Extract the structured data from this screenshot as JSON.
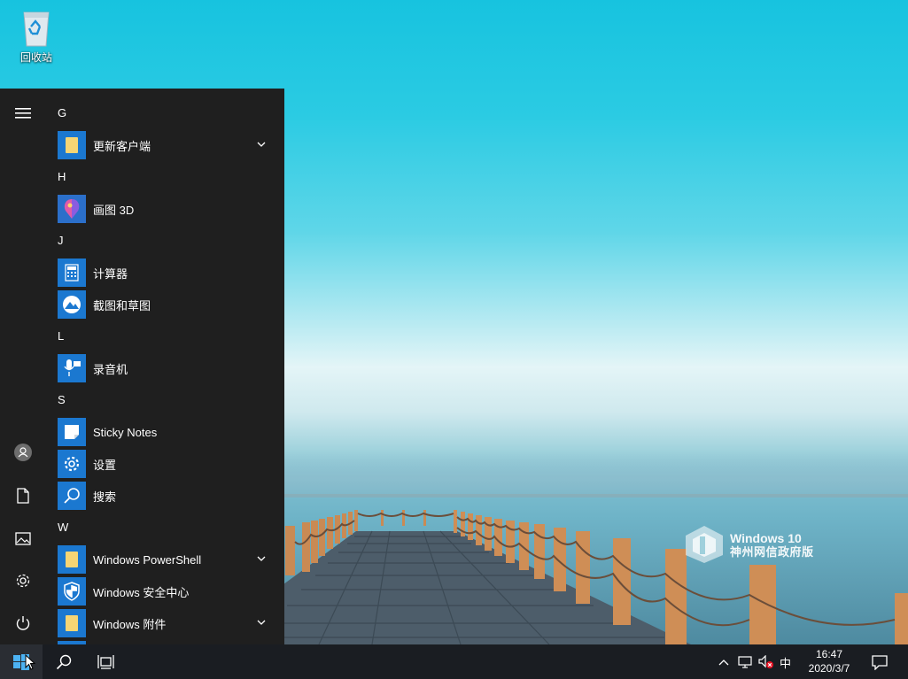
{
  "desktop": {
    "icons": [
      {
        "label": "回收站",
        "icon": "recycle-bin-icon"
      }
    ],
    "watermark": {
      "line1": "Windows 10",
      "line2": "神州网信政府版"
    }
  },
  "start_menu": {
    "rail": [
      "hamburger-menu-icon",
      "user-avatar-icon",
      "documents-icon",
      "pictures-icon",
      "settings-icon",
      "power-icon"
    ],
    "sections": [
      {
        "letter": "G",
        "apps": [
          {
            "name": "更新客户端",
            "icon": "folder-icon",
            "expandable": true
          }
        ]
      },
      {
        "letter": "H",
        "apps": [
          {
            "name": "画图 3D",
            "icon": "paint3d-icon",
            "expandable": false
          }
        ]
      },
      {
        "letter": "J",
        "apps": [
          {
            "name": "计算器",
            "icon": "calculator-icon",
            "expandable": false
          },
          {
            "name": "截图和草图",
            "icon": "snip-sketch-icon",
            "expandable": false
          }
        ]
      },
      {
        "letter": "L",
        "apps": [
          {
            "name": "录音机",
            "icon": "voice-recorder-icon",
            "expandable": false
          }
        ]
      },
      {
        "letter": "S",
        "apps": [
          {
            "name": "Sticky Notes",
            "icon": "sticky-notes-icon",
            "expandable": false
          },
          {
            "name": "设置",
            "icon": "gear-icon",
            "expandable": false
          },
          {
            "name": "搜索",
            "icon": "search-icon",
            "expandable": false
          }
        ]
      },
      {
        "letter": "W",
        "apps": [
          {
            "name": "Windows PowerShell",
            "icon": "folder-icon",
            "expandable": true
          },
          {
            "name": "Windows 安全中心",
            "icon": "shield-icon",
            "expandable": false
          },
          {
            "name": "Windows 附件",
            "icon": "folder-icon",
            "expandable": true
          }
        ]
      }
    ]
  },
  "taskbar": {
    "buttons": [
      "windows-start-icon",
      "search-icon",
      "task-view-icon"
    ],
    "tray": {
      "icons": [
        "chevron-up-icon",
        "network-icon",
        "volume-muted-icon"
      ],
      "ime": "中",
      "time": "16:47",
      "date": "2020/3/7",
      "notification_icon": "action-center-icon"
    }
  },
  "colors": {
    "start_menu_bg": "#1f1f1f",
    "tile_blue": "#1b78d0",
    "taskbar_bg": "#1a1d22",
    "sky": "#17c3df"
  }
}
